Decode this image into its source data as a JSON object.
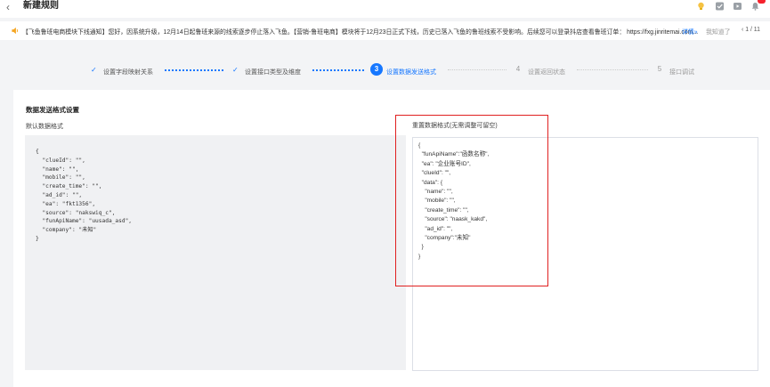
{
  "header": {
    "back_glyph": "‹",
    "title": "新建规则",
    "icons": [
      "back-icon",
      "lightbulb-icon",
      "checkbox-icon",
      "video-icon",
      "bell-icon"
    ]
  },
  "notice": {
    "message": "【飞鱼鲁班电商模块下线通知】您好，因系统升级，12月14日起鲁班来源的线索逐步停止落入飞鱼。【营销-鲁班电商】模块将于12月23日正式下线，历史已落入飞鱼的鲁班线索不受影响。后续您可以登录抖店查看鲁班订单： https://fxg.jinritemai.com...",
    "detail_label": "详情»",
    "known_label": "我知道了",
    "pager": "‹ 1 / 11"
  },
  "steps": [
    {
      "label": "设置字段映射关系",
      "status": "done"
    },
    {
      "label": "设置接口类型及维度",
      "status": "done"
    },
    {
      "num": "3",
      "label": "设置数据发送格式",
      "status": "active"
    },
    {
      "num": "4",
      "label": "设置返回状态",
      "status": "todo"
    },
    {
      "num": "5",
      "label": "接口调试",
      "status": "todo"
    }
  ],
  "form": {
    "section_title": "数据发送格式设置",
    "default_label": "默认数据格式",
    "reset_label": "重置数据格式(无需调整可留空)",
    "default_code": "{\n  \"clueId\": \"\",\n  \"name\": \"\",\n  \"mobile\": \"\",\n  \"create_time\": \"\",\n  \"ad_id\": \"\",\n  \"ea\": \"fkt1356\",\n  \"source\": \"nakswiq_c\",\n  \"funApiName\": \"uusada_asd\",\n  \"company\": \"未知\"\n}",
    "custom_code": "{\n  \"funApiName\":\"函数名称\",\n  \"ea\": \"企业账号ID\",\n  \"clueId\": \"\",\n  \"data\": {\n    \"name\": \"\",\n    \"mobile\": \"\",\n    \"create_time\": \"\",\n    \"source\": \"naask_kakd\",\n    \"ad_id\": \"\",\n    \"company\":\"未知\"\n  }\n}"
  },
  "colors": {
    "accent": "#1677ff",
    "highlight": "#e02020",
    "badge": "#f5222d"
  }
}
